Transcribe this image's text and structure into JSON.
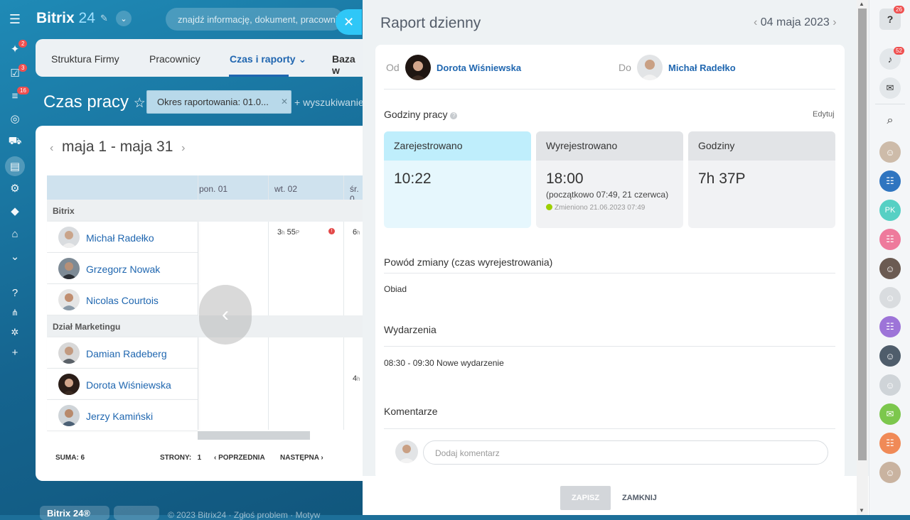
{
  "header": {
    "logo_main": "Bitrix",
    "logo_num": "24",
    "search_placeholder": "znajdź informację, dokument, pracownika"
  },
  "sidebar_badges": [
    "2",
    "3",
    "16"
  ],
  "tabs": [
    "Struktura Firmy",
    "Pracownicy",
    "Czas i raporty",
    "Baza w"
  ],
  "page_title": "Czas pracy",
  "filter": {
    "chip": "Okres raportowania: 01.0...",
    "search": "+ wyszukiwanie"
  },
  "calendar": {
    "range": "maja 1 - maja 31",
    "columns": [
      "pon. 01",
      "wt. 02",
      "śr. 0"
    ],
    "groups": [
      "Bitrix",
      "Dział Marketingu"
    ],
    "rows": [
      "Michał Radełko",
      "Grzegorz Nowak",
      "Nicolas Courtois",
      "Damian Radeberg",
      "Dorota Wiśniewska",
      "Jerzy Kamiński"
    ],
    "cell_value_hours": "3",
    "cell_h": "h",
    "cell_value_minutes": "55",
    "cell_p": "P",
    "cell_partial": "6",
    "cell_partial_h": "h",
    "cell_partial2": "4",
    "cell_partial2_h": "h",
    "footer": {
      "sum": "SUMA: 6",
      "pages": "STRONY:",
      "page_num": "1",
      "prev": "POPRZEDNIA",
      "next": "NASTĘPNA"
    }
  },
  "bottom": {
    "logo": "Bitrix 24®",
    "text": "© 2023 Bitrix24 · Zgłoś problem · Motyw"
  },
  "report": {
    "title": "Raport dzienny",
    "date": "04 maja 2023",
    "from_label": "Od",
    "from_name": "Dorota Wiśniewska",
    "to_label": "Do",
    "to_name": "Michał Radełko",
    "hours_title": "Godziny pracy",
    "edit": "Edytuj",
    "registered": {
      "label": "Zarejestrowano",
      "value": "10:22"
    },
    "unregistered": {
      "label": "Wyrejestrowano",
      "value": "18:00",
      "sub": "(początkowo 07:49, 21 czerwca)",
      "changed": "Zmieniono 21.06.2023 07:49"
    },
    "hours": {
      "label": "Godziny",
      "value": "7h 37P"
    },
    "reason_title": "Powód zmiany (czas wyrejestrowania)",
    "reason": "Obiad",
    "events_title": "Wydarzenia",
    "event": "08:30 - 09:30 Nowe wydarzenie",
    "comments_title": "Komentarze",
    "comment_placeholder": "Dodaj komentarz",
    "save": "ZAPISZ",
    "close": "ZAMKNIJ"
  },
  "right_bar": {
    "help_badge": "26",
    "bell_badge": "52",
    "initials": "PK"
  },
  "colors": {
    "accent": "#2067b0",
    "registered": "#bfeefc",
    "close_button": "#2fc7f7"
  }
}
